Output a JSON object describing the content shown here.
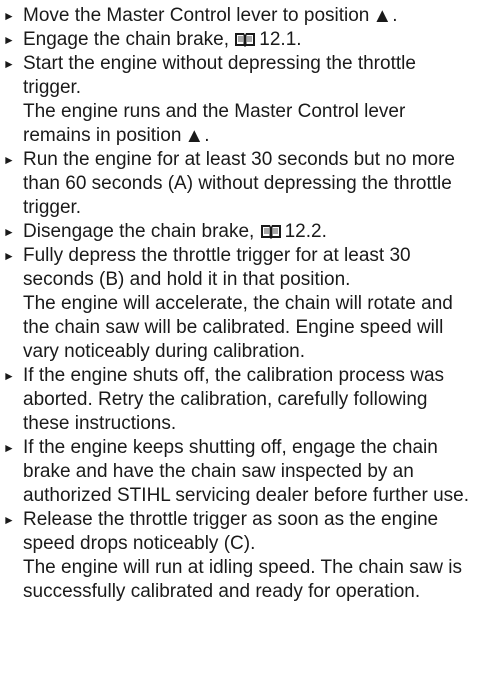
{
  "steps": [
    {
      "text": "Move the Master Control lever to position",
      "trailing_icon": "triangle-up-icon",
      "trailing_end": "."
    },
    {
      "text": "Engage the chain brake,",
      "ref_icon": "book-icon",
      "ref": "12.1."
    },
    {
      "text": "Start the engine without depressing the throttle trigger.",
      "result_a": "The engine runs and the Master Control lever",
      "result_b": "remains in position",
      "result_icon": "triangle-up-icon",
      "result_end": "."
    },
    {
      "text": "Run the engine for at least 30 seconds but no more than 60 seconds (A) without depressing the throttle trigger."
    },
    {
      "text": "Disengage the chain brake,",
      "ref_icon": "book-icon",
      "ref": "12.2."
    },
    {
      "text": "Fully depress the throttle trigger for at least 30 seconds (B) and hold it in that position.",
      "result": "The engine will accelerate, the chain will rotate and the chain saw will be calibrated. Engine speed will vary noticeably during calibration."
    },
    {
      "text": "If the engine shuts off, the calibration process was aborted. Retry the calibration, carefully following these instructions."
    },
    {
      "text": "If the engine keeps shutting off, engage the chain brake and have the chain saw inspected by an authorized STIHL servicing dealer before further use."
    },
    {
      "text": "Release the throttle trigger as soon as the engine speed drops noticeably (C).",
      "result": "The engine will run at idling speed. The chain saw is successfully calibrated and ready for operation."
    }
  ]
}
